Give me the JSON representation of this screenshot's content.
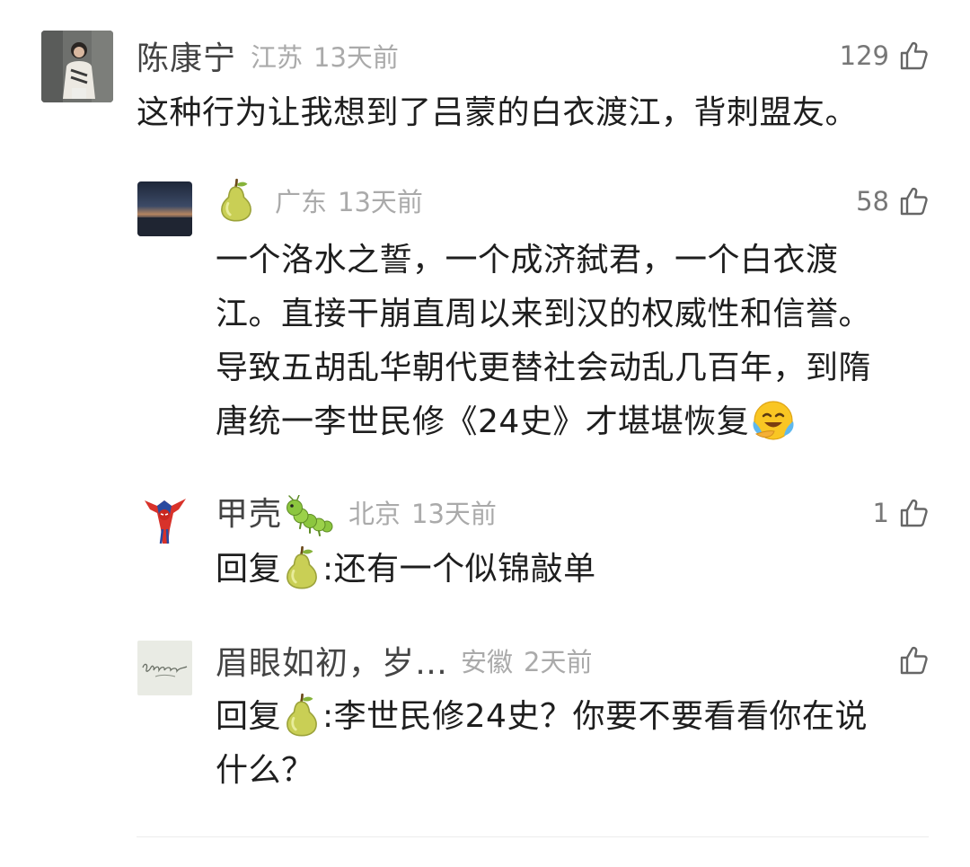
{
  "comments": [
    {
      "username": "陈康宁",
      "location": "江苏",
      "time": "13天前",
      "likes": "129",
      "avatar_icon": "girl-photo-avatar",
      "text": "这种行为让我想到了吕蒙的白衣渡江，背刺盟友。"
    },
    {
      "username": "",
      "username_icon": "pear-emoji",
      "location": "广东",
      "time": "13天前",
      "likes": "58",
      "avatar_icon": "sunset-photo-avatar",
      "text_lines": [
        "一个洛水之誓，一个成济弑君，一个白衣渡",
        "江。直接干崩直周以来到汉的权威性和信誉。",
        "导致五胡乱华朝代更替社会动乱几百年，到隋",
        "唐统一李世民修《24史》才堪堪恢复"
      ],
      "trailing_emoji": "face-with-tears-emoji"
    },
    {
      "username": "甲壳",
      "username_icon": "caterpillar-emoji",
      "location": "北京",
      "time": "13天前",
      "likes": "1",
      "avatar_icon": "spiderman-avatar",
      "reply_prefix": "回复",
      "reply_target_icon": "pear-emoji",
      "reply_sep": ":",
      "text": "还有一个似锦敲单"
    },
    {
      "username": "眉眼如初，岁…",
      "location": "安徽",
      "time": "2天前",
      "likes": "",
      "avatar_icon": "handwriting-avatar",
      "reply_prefix": "回复",
      "reply_target_icon": "pear-emoji",
      "reply_sep": ":",
      "text_lines": [
        "李世民修24史？你要不要看看你在说",
        "什么？"
      ]
    }
  ],
  "colors": {
    "text": "#1e1e1e",
    "username": "#444444",
    "meta": "#aaaaaa",
    "like_icon": "#666666"
  }
}
